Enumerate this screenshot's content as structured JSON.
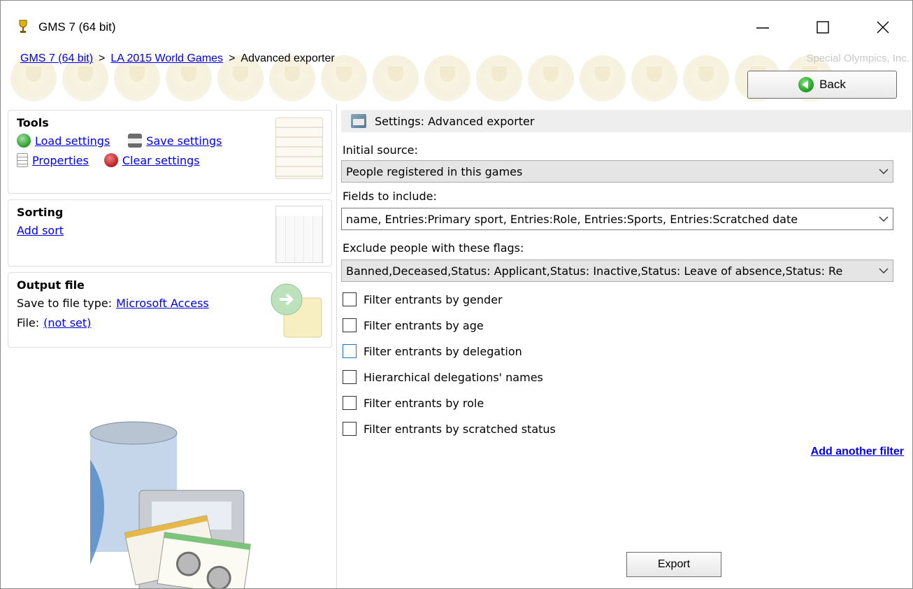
{
  "window": {
    "title": "GMS 7 (64 bit)"
  },
  "breadcrumb": {
    "items": [
      "GMS 7 (64 bit)",
      "LA 2015 World Games",
      "Advanced exporter"
    ],
    "separator": ">"
  },
  "brand": "Special Olympics, Inc.",
  "back_label": "Back",
  "tools": {
    "title": "Tools",
    "load": "Load settings",
    "save": "Save settings",
    "properties": "Properties",
    "clear": "Clear settings"
  },
  "sorting": {
    "title": "Sorting",
    "add": "Add sort"
  },
  "output": {
    "title": "Output file",
    "type_label": "Save to file type:",
    "type_value": "Microsoft Access",
    "file_label": "File:",
    "file_value": "(not set)"
  },
  "settings": {
    "header": "Settings: Advanced exporter",
    "initial_source_label": "Initial source:",
    "initial_source_value": "People registered in this games",
    "fields_label": "Fields to include:",
    "fields_value": "name, Entries:Primary sport, Entries:Role, Entries:Sports, Entries:Scratched date",
    "exclude_label": "Exclude people with these flags:",
    "exclude_value": "Banned,Deceased,Status: Applicant,Status: Inactive,Status: Leave of absence,Status: Re",
    "filters": [
      {
        "label": "Filter entrants by gender",
        "checked": false
      },
      {
        "label": "Filter entrants by age",
        "checked": false
      },
      {
        "label": "Filter entrants by delegation",
        "checked": false
      },
      {
        "label": "Hierarchical delegations' names",
        "checked": false
      },
      {
        "label": "Filter entrants by role",
        "checked": false
      },
      {
        "label": "Filter entrants by scratched status",
        "checked": false
      }
    ],
    "add_filter": "Add another filter",
    "export": "Export"
  },
  "colors": {
    "link": "#0000ee",
    "header_bg": "#eeeeee",
    "combo_bg": "#e5e5e5",
    "focus": "#1e74c8"
  },
  "icons": [
    "trophy-icon",
    "minimize-icon",
    "maximize-icon",
    "close-icon",
    "back-arrow-icon",
    "load-icon",
    "save-icon",
    "properties-icon",
    "clear-icon",
    "settings-icon",
    "chevron-down-icon"
  ]
}
